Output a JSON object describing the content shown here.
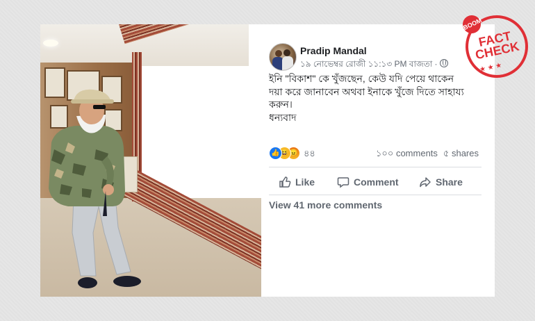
{
  "post": {
    "author": "Pradip Mandal",
    "meta": "১৯ নোভেম্বর রোজী ১১:১৩ PM বাজতা ·",
    "body_line1": "ইনি \"বিকাশ\" কে খুঁজছেন, কেউ যদি পেয়ে থাকেন",
    "body_line2": "দয়া করে জানাবেন অথবা ইনাকে খুঁজে দিতে সাহায্য",
    "body_line3": "করুন।",
    "body_line4": "ধন্যবাদ",
    "reaction_count": "৪৪",
    "comments_count": "১০০ comments",
    "shares_count": "৫ shares",
    "like_label": "Like",
    "comment_label": "Comment",
    "share_label": "Share",
    "view_more": "View 41 more comments"
  },
  "stamp": {
    "boom": "BOOM",
    "line1": "FACT",
    "line2": "CHECK"
  },
  "icons": {
    "reactions": [
      "like-icon",
      "haha-icon",
      "angry-icon"
    ],
    "actions": [
      "thumbs-up-icon",
      "comment-bubble-icon",
      "share-arrow-icon"
    ],
    "privacy": "globe-icon"
  },
  "colors": {
    "stamp_red": "#e02f36",
    "facebook_blue": "#1877f2",
    "muted_text": "#606770"
  }
}
